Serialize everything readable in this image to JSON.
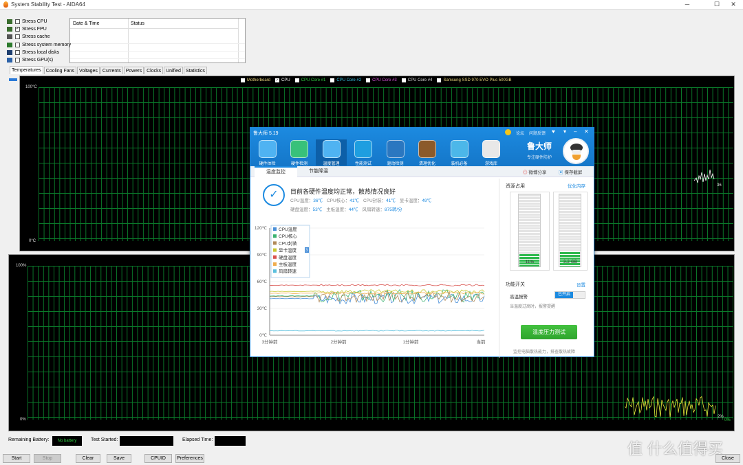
{
  "window": {
    "title": "System Stability Test - AIDA64"
  },
  "stress_options": [
    {
      "label": "Stress CPU",
      "checked": false
    },
    {
      "label": "Stress FPU",
      "checked": true
    },
    {
      "label": "Stress cache",
      "checked": false
    },
    {
      "label": "Stress system memory",
      "checked": false
    },
    {
      "label": "Stress local disks",
      "checked": false
    },
    {
      "label": "Stress GPU(s)",
      "checked": false
    }
  ],
  "log_table": {
    "col1": "Date & Time",
    "col2": "Status"
  },
  "tabs": [
    "Temperatures",
    "Cooling Fans",
    "Voltages",
    "Currents",
    "Powers",
    "Clocks",
    "Unified",
    "Statistics"
  ],
  "temp_graph": {
    "legend": [
      {
        "label": "Motherboard",
        "color": "#e8d27a",
        "checked": false
      },
      {
        "label": "CPU",
        "color": "#ffffff",
        "checked": true
      },
      {
        "label": "CPU Core #1",
        "color": "#2ecc40",
        "checked": false
      },
      {
        "label": "CPU Core #2",
        "color": "#34c6e8",
        "checked": false
      },
      {
        "label": "CPU Core #3",
        "color": "#d850d8",
        "checked": false
      },
      {
        "label": "CPU Core #4",
        "color": "#dddddd",
        "checked": false
      },
      {
        "label": "Samsung SSD 970 EVO Plus 500GB",
        "color": "#e8d27a",
        "checked": false
      }
    ],
    "top": "100°C",
    "bottom": "0°C",
    "current": "36"
  },
  "usage_graph": {
    "top": "100%",
    "bottom": "0%",
    "current1": "2%",
    "current2": "0%"
  },
  "status_bar": {
    "battery_label": "Remaining Battery:",
    "battery_value": "No battery",
    "started_label": "Test Started:",
    "elapsed_label": "Elapsed Time:"
  },
  "buttons": [
    "Start",
    "Stop",
    "Clear",
    "Save",
    "CPUID",
    "Preferences",
    "Close"
  ],
  "watermark": "值 什么值得买",
  "ludashi": {
    "version": "鲁大师 5.19",
    "top_links": [
      "论坛",
      "问题反馈"
    ],
    "brand": "鲁大师",
    "brand_sub": "专注硬件防护",
    "nav": [
      "硬件体检",
      "硬件检测",
      "温度管理",
      "性能测试",
      "驱动检测",
      "清理优化",
      "装机必备",
      "游戏库"
    ],
    "sub_tabs": [
      "温度监控",
      "节能降温"
    ],
    "share": "微博分享",
    "save_shot": "保存截屏",
    "status_msg": "目前各硬件温度均正常，散热情况良好",
    "readings_row1": [
      {
        "label": "CPU温度：",
        "value": "36℃"
      },
      {
        "label": "CPU核心：",
        "value": "41℃"
      },
      {
        "label": "CPU封装：",
        "value": "41℃"
      },
      {
        "label": "显卡温度：",
        "value": "49℃"
      }
    ],
    "readings_row2": [
      {
        "label": "硬盘温度：",
        "value": "53℃"
      },
      {
        "label": "主板温度：",
        "value": "44℃"
      },
      {
        "label": "风扇转速：",
        "value": "875转/分"
      }
    ],
    "chart_legend": [
      {
        "label": "CPU温度",
        "color": "#4a90d9"
      },
      {
        "label": "CPU核心",
        "color": "#3cb371"
      },
      {
        "label": "CPU封装",
        "color": "#b08a5a"
      },
      {
        "label": "显卡温度",
        "color": "#c8c832"
      },
      {
        "label": "硬盘温度",
        "color": "#d9534f"
      },
      {
        "label": "主板温度",
        "color": "#f0ad4e"
      },
      {
        "label": "风扇转速",
        "color": "#5bc0de"
      }
    ],
    "chart_badge": "3",
    "y_ticks": [
      "120℃",
      "90℃",
      "60℃",
      "30℃",
      "0℃"
    ],
    "x_ticks": [
      "3分钟前",
      "2分钟前",
      "1分钟前",
      "当前"
    ],
    "resources_title": "资源占用",
    "optimize_mem": "优化内存",
    "cpu_label": "CPU使用",
    "cpu_value": "11%",
    "cpu_fraction": 0.11,
    "mem_label": "内存使用",
    "mem_value": "3.2 GB",
    "mem_fraction": 0.2,
    "switch_title": "功能开关",
    "settings": "设置",
    "alarm_label": "高温报警",
    "alarm_state": "已开启",
    "alarm_desc": "当温度过高时，报警提醒",
    "stress_btn": "温度压力测试",
    "stress_desc": "监控电脑散热能力，排查散热故障"
  }
}
